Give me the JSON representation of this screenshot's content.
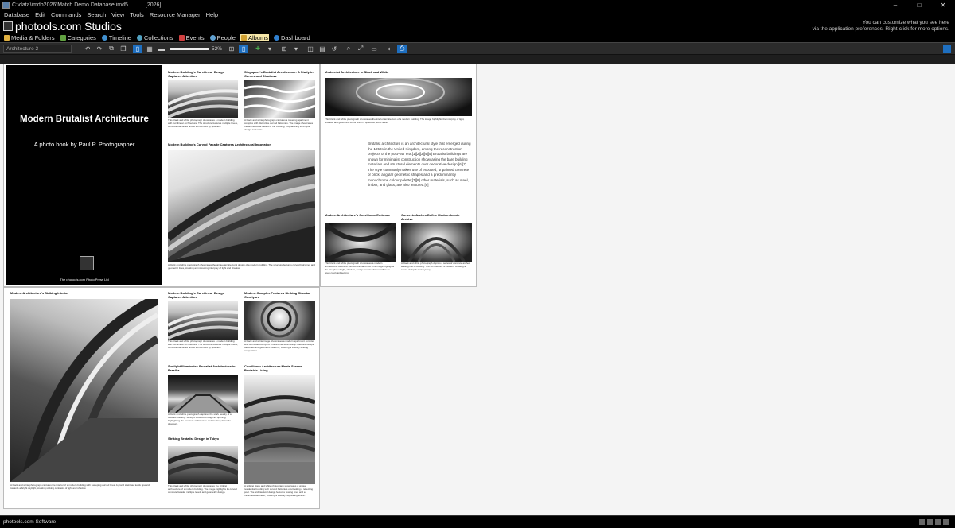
{
  "window": {
    "title": "C:\\data\\imdb2026\\Match Demo Database.imd5",
    "year": "[2026]",
    "controls": [
      "–",
      "□",
      "✕"
    ]
  },
  "menu": [
    "Database",
    "Edit",
    "Commands",
    "Search",
    "View",
    "Tools",
    "Resource Manager",
    "Help"
  ],
  "brand": {
    "name": "photools.com Studios"
  },
  "hint": {
    "line1": "You can customize what you see here",
    "line2": "via the application preferences. Right-click for more options."
  },
  "nav": [
    {
      "label": "Media & Folders",
      "color": "#e0b040"
    },
    {
      "label": "Categories",
      "color": "#60a040"
    },
    {
      "label": "Timeline",
      "color": "#4090d0"
    },
    {
      "label": "Collections",
      "color": "#50a0c0"
    },
    {
      "label": "Events",
      "color": "#d04040"
    },
    {
      "label": "People",
      "color": "#60a0d0"
    },
    {
      "label": "Albums",
      "color": "#d0a030"
    },
    {
      "label": "Dashboard",
      "color": "#3080d0"
    }
  ],
  "toolbar": {
    "album": "Architecture 2",
    "zoom": "52%"
  },
  "cover": {
    "title": "Modern Brutalist Architecture",
    "subtitle": "A photo book by Paul P. Photographer",
    "publisher": "The photools.com Photo Press Ltd"
  },
  "cards": [
    {
      "title": "Modern Building's Curvilinear Design Captures Attention",
      "caption": "This black and white photograph showcases a modern building with curvilinear architecture. The structure features multiple levels, concrete balconies and is surrounded by greenery."
    },
    {
      "title": "Singapore's Brutalist Architecture: A Study in Curves and Shadows",
      "caption": "A black and white photograph captures a towering apartment complex with distinctive curved balconies. The image showcases the architectural details of the building, emphasizing its unique design and scale."
    },
    {
      "title": "Modern Building's Curved Facade Captures Architectural Innovation",
      "caption": "A black and white photograph showcases the unique architectural design of a modern building. The structure features curved balconies and geometric lines, creating an interesting interplay of light and shadow."
    },
    {
      "title": "Modernist Architecture in Black and White",
      "caption": "This black and white photograph showcases the interior architecture of a modern building. The image highlights the interplay of light, shadow, and geometric forms within a spacious public area."
    },
    {
      "title": "Modern Architecture's Curvilinear Embrace",
      "caption": "This black and white photograph showcases a modern architectural structure with curvilinear forms. The image highlights the interplay of light, shadow, and geometric shapes within an open courtyard setting."
    },
    {
      "title": "Concrete Arches Define Modern Iconic Archive",
      "caption": "A black and white photograph depicts a series of concrete arches leading into a building. The architecture is modern, creating a sense of depth and mystery."
    },
    {
      "title": "Modern Architecture's Striking Interior",
      "caption": "A black and white photograph captures the interior of a modern building with sweeping curved lines. A grand staircase leads upwards towards a bright skylight, creating striking contrasts of light and shadow."
    },
    {
      "title": "Modern Building's Curvilinear Design Captures Attention",
      "caption": "This black and white photograph showcases a modern building with curvilinear architecture. The structure features multiple levels, concrete balconies and is surrounded by greenery."
    },
    {
      "title": "Modern Complex Features Striking Circular Courtyard",
      "caption": "A black and white image showcases a modern apartment complex with a circular courtyard. The architectural design features multiple balconies and geometric patterns, creating a visually striking composition."
    },
    {
      "title": "Sunlight Illuminates Brutalist Architecture in Brasilia",
      "caption": "A black and white photograph captures the stark beauty of a brutalist building. Sunlight streams through an opening, highlighting the concrete architecture and creating dramatic shadows."
    },
    {
      "title": "Curvilinear Architecture Meets Serene Poolside Living",
      "caption": "A striking black and white photograph showcases a unique residential building with curved balconies overlooking a reflecting pool. The architectural design features flowing lines and a minimalist aesthetic, creating a visually captivating scene."
    },
    {
      "title": "Striking Brutalist Design in Tokyo",
      "caption": "This black and white photograph showcases the striking architecture of a modern building. The image highlights its curved concrete facade, multiple levels and geometric design."
    }
  ],
  "body_text": "Brutalist architecture is an architectural style that emerged during the 1950s in the United Kingdom, among the reconstruction projects of the post-war era.[1][2][3][4][5] Brutalist buildings are known for minimalist construction showcasing the bare building materials and structural elements over decorative design.[6][7] The style commonly makes use of exposed, unpainted concrete or brick, angular geometric shapes and a predominantly monochrome colour palette;[7][8] other materials, such as steel, timber, and glass, are also featured.[9]",
  "status": {
    "label": "photools.com Software"
  }
}
